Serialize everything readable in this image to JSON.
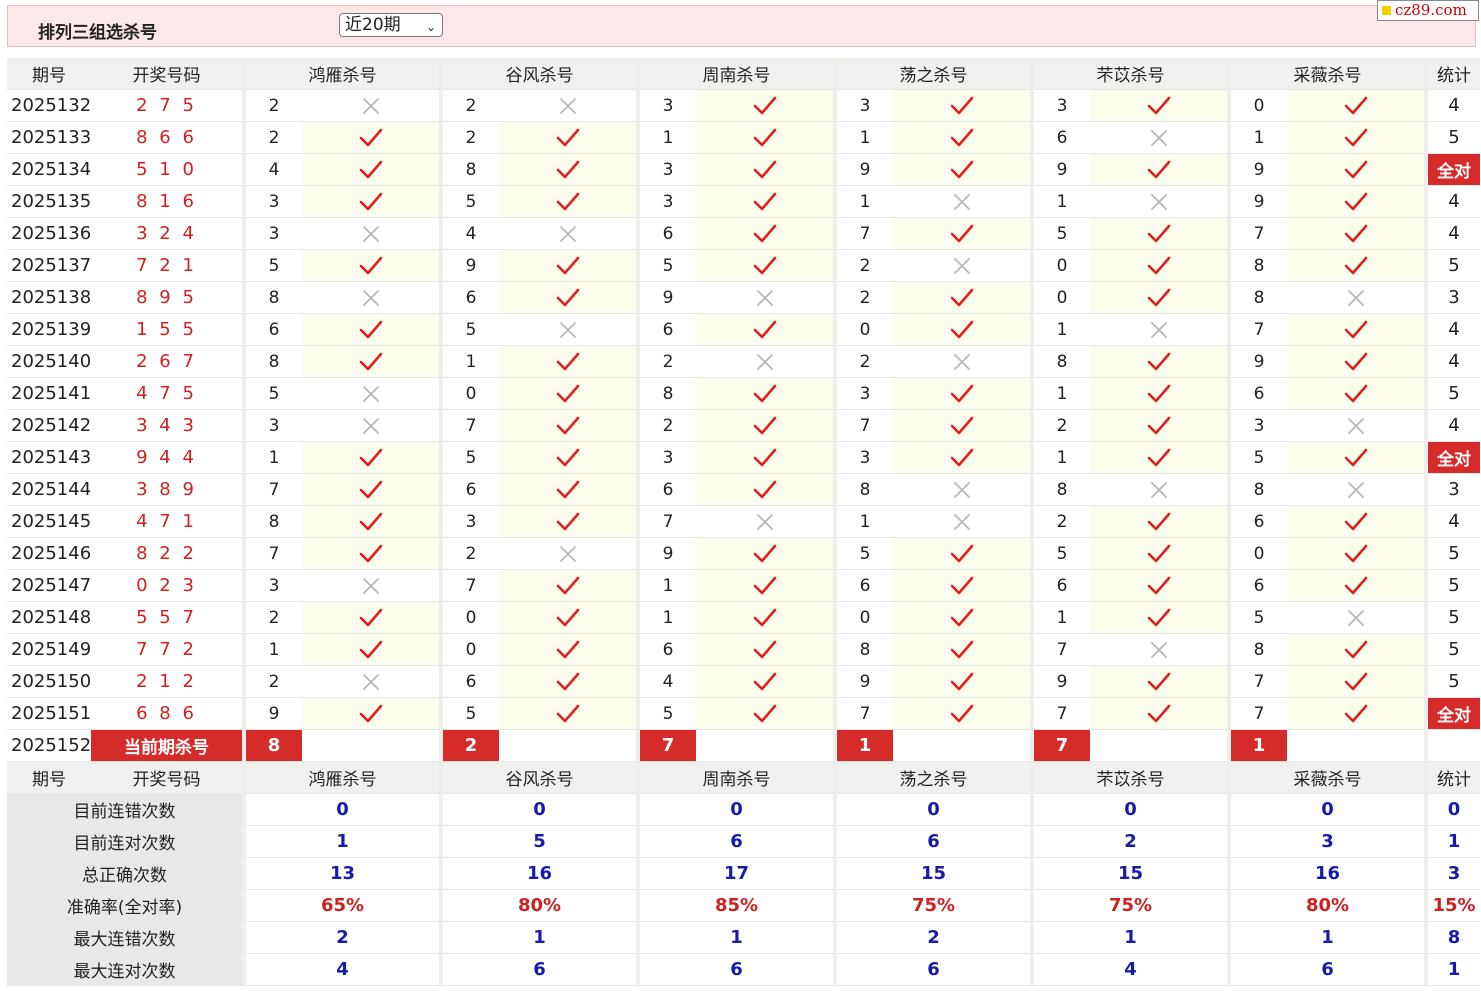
{
  "header": {
    "title": "排列三组选杀号",
    "range_value": "近20期",
    "site_badge": "cz89.com"
  },
  "columns": {
    "period": "期号",
    "draw": "开奖号码",
    "stat": "统计"
  },
  "experts": [
    "鸿雁杀号",
    "谷风杀号",
    "周南杀号",
    "荡之杀号",
    "芣苡杀号",
    "采薇杀号"
  ],
  "all_correct_label": "全对",
  "rows": [
    {
      "period": "2025132",
      "draw": "2 7 5",
      "kills": [
        2,
        2,
        3,
        3,
        3,
        0
      ],
      "ok": [
        0,
        0,
        1,
        1,
        1,
        1
      ],
      "stat": "4"
    },
    {
      "period": "2025133",
      "draw": "8 6 6",
      "kills": [
        2,
        2,
        1,
        1,
        6,
        1
      ],
      "ok": [
        1,
        1,
        1,
        1,
        0,
        1
      ],
      "stat": "5"
    },
    {
      "period": "2025134",
      "draw": "5 1 0",
      "kills": [
        4,
        8,
        3,
        9,
        9,
        9
      ],
      "ok": [
        1,
        1,
        1,
        1,
        1,
        1
      ],
      "stat": "全对"
    },
    {
      "period": "2025135",
      "draw": "8 1 6",
      "kills": [
        3,
        5,
        3,
        1,
        1,
        9
      ],
      "ok": [
        1,
        1,
        1,
        0,
        0,
        1
      ],
      "stat": "4"
    },
    {
      "period": "2025136",
      "draw": "3 2 4",
      "kills": [
        3,
        4,
        6,
        7,
        5,
        7
      ],
      "ok": [
        0,
        0,
        1,
        1,
        1,
        1
      ],
      "stat": "4"
    },
    {
      "period": "2025137",
      "draw": "7 2 1",
      "kills": [
        5,
        9,
        5,
        2,
        0,
        8
      ],
      "ok": [
        1,
        1,
        1,
        0,
        1,
        1
      ],
      "stat": "5"
    },
    {
      "period": "2025138",
      "draw": "8 9 5",
      "kills": [
        8,
        6,
        9,
        2,
        0,
        8
      ],
      "ok": [
        0,
        1,
        0,
        1,
        1,
        0
      ],
      "stat": "3"
    },
    {
      "period": "2025139",
      "draw": "1 5 5",
      "kills": [
        6,
        5,
        6,
        0,
        1,
        7
      ],
      "ok": [
        1,
        0,
        1,
        1,
        0,
        1
      ],
      "stat": "4"
    },
    {
      "period": "2025140",
      "draw": "2 6 7",
      "kills": [
        8,
        1,
        2,
        2,
        8,
        9
      ],
      "ok": [
        1,
        1,
        0,
        0,
        1,
        1
      ],
      "stat": "4"
    },
    {
      "period": "2025141",
      "draw": "4 7 5",
      "kills": [
        5,
        0,
        8,
        3,
        1,
        6
      ],
      "ok": [
        0,
        1,
        1,
        1,
        1,
        1
      ],
      "stat": "5"
    },
    {
      "period": "2025142",
      "draw": "3 4 3",
      "kills": [
        3,
        7,
        2,
        7,
        2,
        3
      ],
      "ok": [
        0,
        1,
        1,
        1,
        1,
        0
      ],
      "stat": "4"
    },
    {
      "period": "2025143",
      "draw": "9 4 4",
      "kills": [
        1,
        5,
        3,
        3,
        1,
        5
      ],
      "ok": [
        1,
        1,
        1,
        1,
        1,
        1
      ],
      "stat": "全对"
    },
    {
      "period": "2025144",
      "draw": "3 8 9",
      "kills": [
        7,
        6,
        6,
        8,
        8,
        8
      ],
      "ok": [
        1,
        1,
        1,
        0,
        0,
        0
      ],
      "stat": "3"
    },
    {
      "period": "2025145",
      "draw": "4 7 1",
      "kills": [
        8,
        3,
        7,
        1,
        2,
        6
      ],
      "ok": [
        1,
        1,
        0,
        0,
        1,
        1
      ],
      "stat": "4"
    },
    {
      "period": "2025146",
      "draw": "8 2 2",
      "kills": [
        7,
        2,
        9,
        5,
        5,
        0
      ],
      "ok": [
        1,
        0,
        1,
        1,
        1,
        1
      ],
      "stat": "5"
    },
    {
      "period": "2025147",
      "draw": "0 2 3",
      "kills": [
        3,
        7,
        1,
        6,
        6,
        6
      ],
      "ok": [
        0,
        1,
        1,
        1,
        1,
        1
      ],
      "stat": "5"
    },
    {
      "period": "2025148",
      "draw": "5 5 7",
      "kills": [
        2,
        0,
        1,
        0,
        1,
        5
      ],
      "ok": [
        1,
        1,
        1,
        1,
        1,
        0
      ],
      "stat": "5"
    },
    {
      "period": "2025149",
      "draw": "7 7 2",
      "kills": [
        1,
        0,
        6,
        8,
        7,
        8
      ],
      "ok": [
        1,
        1,
        1,
        1,
        0,
        1
      ],
      "stat": "5"
    },
    {
      "period": "2025150",
      "draw": "2 1 2",
      "kills": [
        2,
        6,
        4,
        9,
        9,
        7
      ],
      "ok": [
        0,
        1,
        1,
        1,
        1,
        1
      ],
      "stat": "5"
    },
    {
      "period": "2025151",
      "draw": "6 8 6",
      "kills": [
        9,
        5,
        5,
        7,
        7,
        7
      ],
      "ok": [
        1,
        1,
        1,
        1,
        1,
        1
      ],
      "stat": "全对"
    }
  ],
  "current": {
    "period": "2025152",
    "label": "当前期杀号",
    "kills": [
      8,
      2,
      7,
      1,
      7,
      1
    ]
  },
  "stats": [
    {
      "label": "目前连错次数",
      "values": [
        "0",
        "0",
        "0",
        "0",
        "0",
        "0"
      ],
      "total": "0",
      "red": false
    },
    {
      "label": "目前连对次数",
      "values": [
        "1",
        "5",
        "6",
        "6",
        "2",
        "3"
      ],
      "total": "1",
      "red": false
    },
    {
      "label": "总正确次数",
      "values": [
        "13",
        "16",
        "17",
        "15",
        "15",
        "16"
      ],
      "total": "3",
      "red": false
    },
    {
      "label": "准确率(全对率)",
      "values": [
        "65%",
        "80%",
        "85%",
        "75%",
        "75%",
        "80%"
      ],
      "total": "15%",
      "red": true
    },
    {
      "label": "最大连错次数",
      "values": [
        "2",
        "1",
        "1",
        "2",
        "1",
        "1"
      ],
      "total": "8",
      "red": false
    },
    {
      "label": "最大连对次数",
      "values": [
        "4",
        "6",
        "6",
        "6",
        "4",
        "6"
      ],
      "total": "1",
      "red": false
    }
  ]
}
